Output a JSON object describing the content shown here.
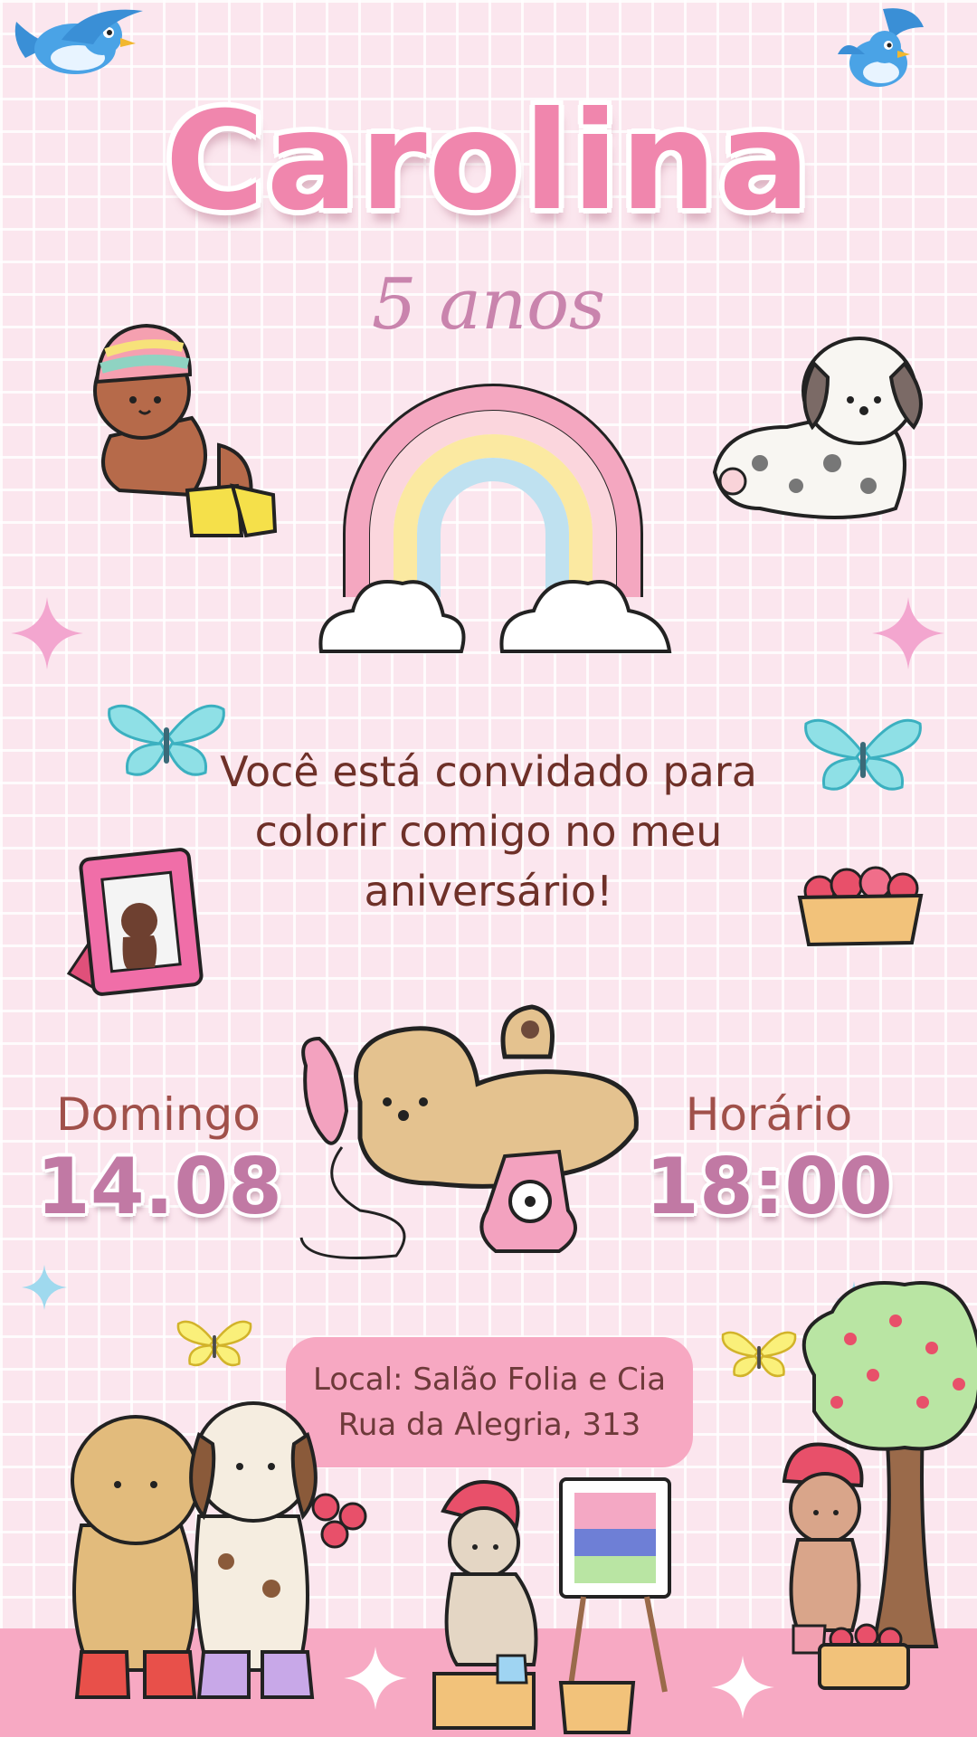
{
  "invitation": {
    "name": "Carolina",
    "age": "5 anos",
    "message_lines": [
      "Você está convidado para",
      "colorir comigo no meu",
      "aniversário!"
    ],
    "day_label": "Domingo",
    "date": "14.08",
    "time_label": "Horário",
    "time": "18:00",
    "location_line1": "Local: Salão Folia e Cia",
    "location_line2": "Rua da Alegria, 313"
  },
  "colors": {
    "background": "#fbe6ee",
    "title_pink": "#f086ad",
    "accent_mauve": "#c179a4",
    "text_brown": "#6e3028",
    "location_pill": "#f7a8c2"
  },
  "decorations": [
    "bluebird-icon",
    "teddy-bear",
    "spotted-puppy",
    "rainbow",
    "butterfly-icon",
    "sparkle-icon",
    "photo-frame",
    "strawberry-basket",
    "puppy-on-phone",
    "strawberry-tree",
    "painting-bunny"
  ]
}
